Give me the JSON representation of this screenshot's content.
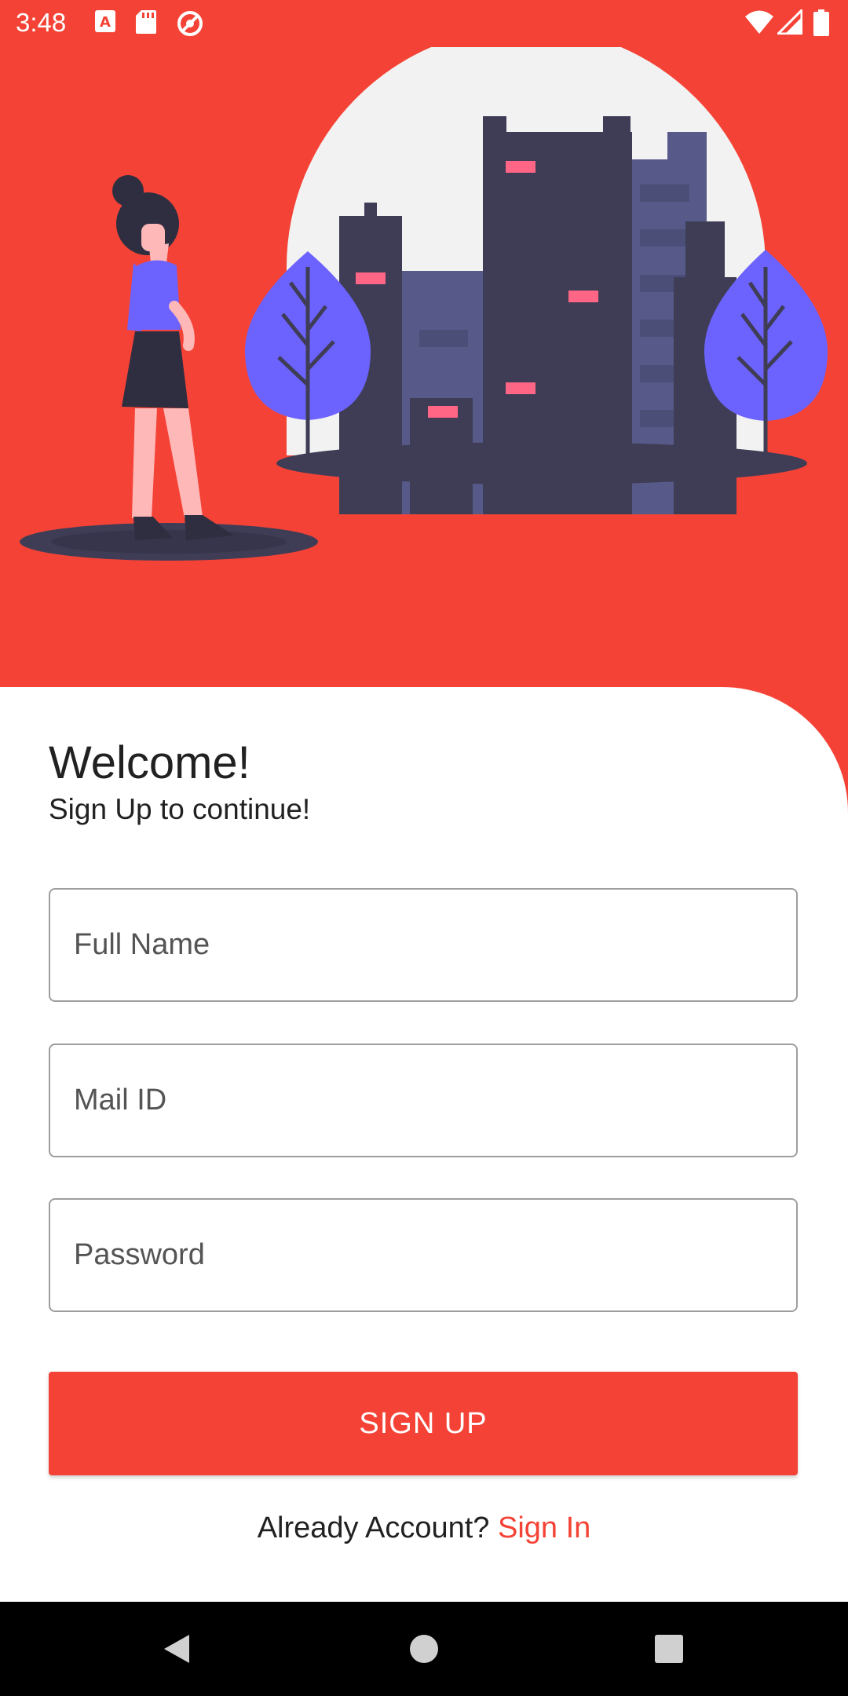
{
  "status_bar": {
    "time": "3:48",
    "left_icons": [
      "a-box-icon",
      "sd-card-icon",
      "no-disturb-icon"
    ],
    "right_icons": [
      "wifi-icon",
      "signal-icon",
      "battery-icon"
    ]
  },
  "colors": {
    "accent": "#f44336",
    "building_dark": "#3f3d56",
    "building_light": "#575a89",
    "tree": "#6c63ff",
    "window": "#ff6584"
  },
  "welcome": {
    "title": "Welcome!",
    "subtitle": "Sign Up to continue!"
  },
  "form": {
    "full_name_placeholder": "Full Name",
    "mail_placeholder": "Mail ID",
    "password_placeholder": "Password",
    "submit_label": "SIGN UP"
  },
  "signin": {
    "prompt": "Already Account?",
    "link": "Sign In"
  },
  "nav_bar": [
    "back-icon",
    "home-icon",
    "recents-icon"
  ]
}
